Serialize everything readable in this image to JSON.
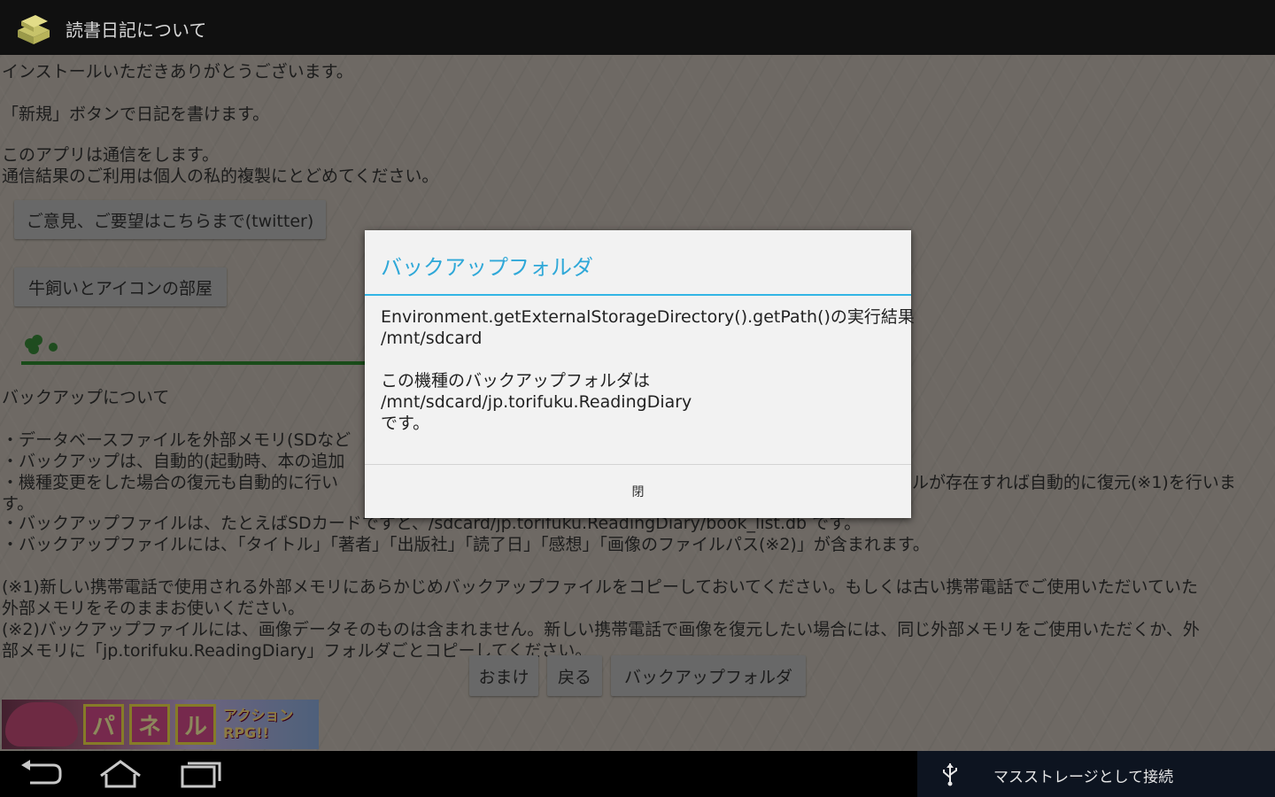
{
  "app": {
    "title": "読書日記について",
    "icon": "book-stack-icon"
  },
  "content": {
    "intro_lines": [
      "インストールいただきありがとうございます。",
      "「新規」ボタンで日記を書けます。",
      "このアプリは通信をします。",
      "通信結果のご利用は個人の私的複製にとどめてください。"
    ],
    "feedback_button": "ご意見、ご要望はこちらまで(twitter)",
    "icon_room_button": "牛飼いとアイコンの部屋",
    "backup_heading": "バックアップについて",
    "backup_lines": [
      "・データベースファイルを外部メモリ(SDなど",
      "・バックアップは、自動的(起動時、本の追加",
      "・機種変更をした場合の復元も自動的に行い",
      "す。",
      "・バックアップファイルは、たとえばSDカードですと、/sdcard/jp.torifuku.ReadingDiary/book_list.db です。",
      "・バックアップファイルには、「タイトル」「著者」「出版社」「読了日」「感想」「画像のファイルパス(※2)」が含まれます。"
    ],
    "backup_line3_tail": "ルが存在すれば自動的に復元(※1)を行いま",
    "notes_lines": [
      "(※1)新しい携帯電話で使用される外部メモリにあらかじめバックアップファイルをコピーしておいてください。もしくは古い携帯電話でご使用いただいていた",
      "外部メモリをそのままお使いください。",
      "(※2)バックアップファイルには、画像データそのものは含まれません。新しい携帯電話で画像を復元したい場合には、同じ外部メモリをご使用いただくか、外",
      "部メモリに「jp.torifuku.ReadingDiary」フォルダごとコピーしてください。"
    ],
    "bottom_buttons": {
      "extra": "おまけ",
      "back": "戻る",
      "backup_folder": "バックアップフォルダ"
    },
    "ad": {
      "panel_letters": [
        "パ",
        "ネ",
        "ル"
      ],
      "tag_line1": "アクション",
      "tag_line2": "RPG!!"
    }
  },
  "dialog": {
    "title": "バックアップフォルダ",
    "lines": [
      "Environment.getExternalStorageDirectory().getPath()の実行結果",
      "/mnt/sdcard",
      "",
      "この機種のバックアップフォルダは",
      "/mnt/sdcard/jp.torifuku.ReadingDiary",
      "です。"
    ],
    "ok_label": "閉"
  },
  "system": {
    "nav_icons": [
      "back-icon",
      "home-icon",
      "recent-apps-icon"
    ],
    "notification_icon": "usb-icon",
    "notification_text": "マスストレージとして接続"
  }
}
